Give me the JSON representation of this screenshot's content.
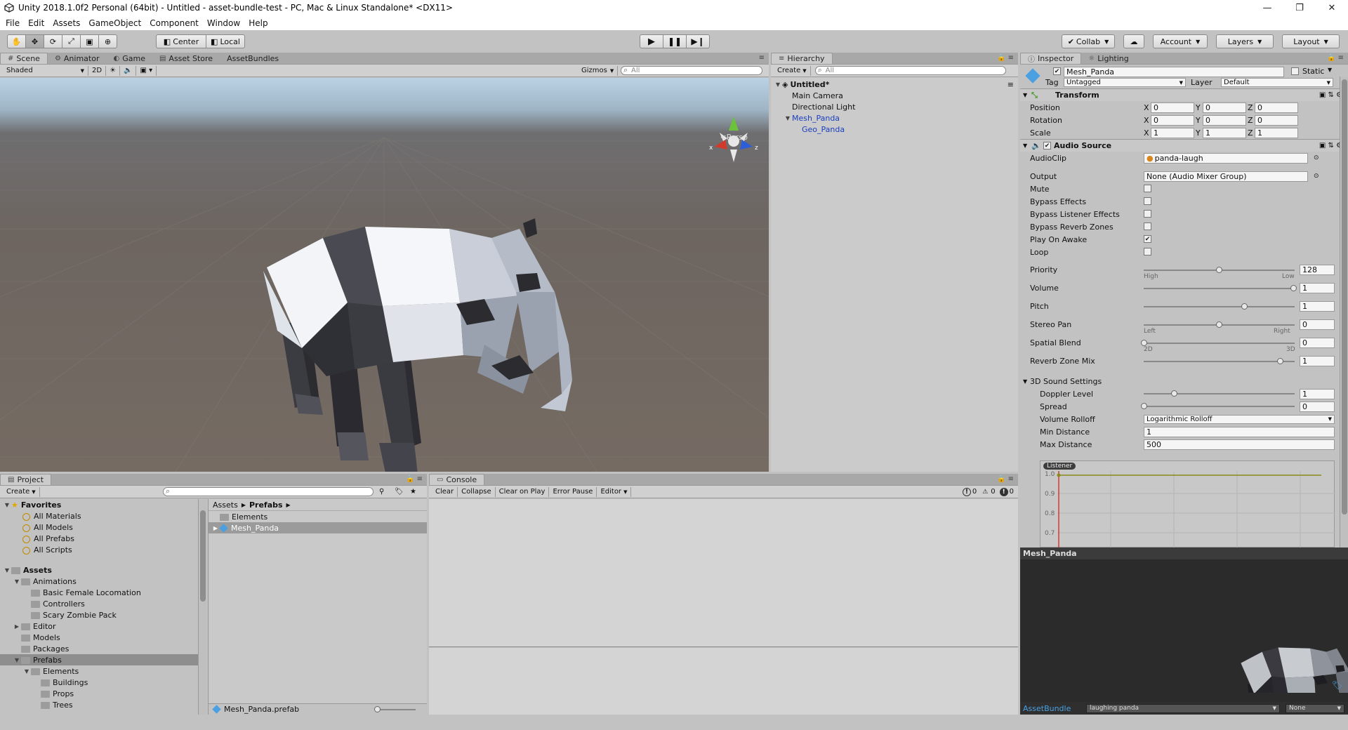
{
  "window": {
    "title": "Unity 2018.1.0f2 Personal (64bit) - Untitled - asset-bundle-test - PC, Mac & Linux Standalone* <DX11>"
  },
  "menu": [
    "File",
    "Edit",
    "Assets",
    "GameObject",
    "Component",
    "Window",
    "Help"
  ],
  "toolbar": {
    "pivot": "Center",
    "space": "Local",
    "collab": "Collab",
    "account": "Account",
    "layers": "Layers",
    "layout": "Layout"
  },
  "scene_panel": {
    "tabs": [
      "Scene",
      "Animator",
      "Game",
      "Asset Store",
      "AssetBundles"
    ],
    "shading": "Shaded",
    "mode_2d": "2D",
    "gizmos": "Gizmos",
    "search_placeholder": "All",
    "persp": "Persp"
  },
  "hierarchy": {
    "tab": "Hierarchy",
    "create": "Create",
    "search_placeholder": "All",
    "scene_name": "Untitled*",
    "items": [
      "Main Camera",
      "Directional Light",
      "Mesh_Panda",
      "Geo_Panda"
    ]
  },
  "inspector": {
    "tabs": [
      "Inspector",
      "Lighting"
    ],
    "object_name": "Mesh_Panda",
    "static_label": "Static",
    "tag_label": "Tag",
    "tag_value": "Untagged",
    "layer_label": "Layer",
    "layer_value": "Default",
    "transform": {
      "title": "Transform",
      "rows": [
        {
          "label": "Position",
          "x": "0",
          "y": "0",
          "z": "0"
        },
        {
          "label": "Rotation",
          "x": "0",
          "y": "0",
          "z": "0"
        },
        {
          "label": "Scale",
          "x": "1",
          "y": "1",
          "z": "1"
        }
      ],
      "axes": [
        "X",
        "Y",
        "Z"
      ]
    },
    "audio": {
      "title": "Audio Source",
      "audioclip_label": "AudioClip",
      "audioclip_value": "panda-laugh",
      "output_label": "Output",
      "output_value": "None (Audio Mixer Group)",
      "toggles": [
        {
          "label": "Mute",
          "checked": false
        },
        {
          "label": "Bypass Effects",
          "checked": false
        },
        {
          "label": "Bypass Listener Effects",
          "checked": false
        },
        {
          "label": "Bypass Reverb Zones",
          "checked": false
        },
        {
          "label": "Play On Awake",
          "checked": true
        },
        {
          "label": "Loop",
          "checked": false
        }
      ],
      "sliders": [
        {
          "label": "Priority",
          "value": "128",
          "pos": 0.5,
          "left": "High",
          "right": "Low"
        },
        {
          "label": "Volume",
          "value": "1",
          "pos": 1.0,
          "left": "",
          "right": ""
        },
        {
          "label": "Pitch",
          "value": "1",
          "pos": 0.67,
          "left": "",
          "right": ""
        },
        {
          "label": "Stereo Pan",
          "value": "0",
          "pos": 0.5,
          "left": "Left",
          "right": "Right"
        },
        {
          "label": "Spatial Blend",
          "value": "0",
          "pos": 0.0,
          "left": "2D",
          "right": "3D"
        },
        {
          "label": "Reverb Zone Mix",
          "value": "1",
          "pos": 0.91,
          "left": "",
          "right": ""
        }
      ],
      "sound3d": {
        "title": "3D Sound Settings",
        "doppler_label": "Doppler Level",
        "doppler_value": "1",
        "doppler_pos": 0.2,
        "spread_label": "Spread",
        "spread_value": "0",
        "spread_pos": 0.0,
        "rolloff_label": "Volume Rolloff",
        "rolloff_value": "Logarithmic Rolloff",
        "min_label": "Min Distance",
        "min_value": "1",
        "max_label": "Max Distance",
        "max_value": "500"
      },
      "graph": {
        "listener": "Listener",
        "ticks": [
          "1.0",
          "0.9",
          "0.8",
          "0.7"
        ]
      }
    }
  },
  "preview": {
    "title": "Mesh_Panda",
    "assetbundle_label": "AssetBundle",
    "assetbundle_value": "laughing panda",
    "variant_value": "None"
  },
  "project": {
    "tab": "Project",
    "create": "Create",
    "favorites_label": "Favorites",
    "favorites": [
      "All Materials",
      "All Models",
      "All Prefabs",
      "All Scripts"
    ],
    "assets_label": "Assets",
    "tree": [
      {
        "label": "Animations",
        "depth": 1,
        "arrow": "▼"
      },
      {
        "label": "Basic Female Locomation",
        "depth": 2,
        "arrow": ""
      },
      {
        "label": "Controllers",
        "depth": 2,
        "arrow": ""
      },
      {
        "label": "Scary Zombie Pack",
        "depth": 2,
        "arrow": ""
      },
      {
        "label": "Editor",
        "depth": 1,
        "arrow": "▶"
      },
      {
        "label": "Models",
        "depth": 1,
        "arrow": ""
      },
      {
        "label": "Packages",
        "depth": 1,
        "arrow": ""
      },
      {
        "label": "Prefabs",
        "depth": 1,
        "arrow": "▼"
      },
      {
        "label": "Elements",
        "depth": 2,
        "arrow": "▼"
      },
      {
        "label": "Buildings",
        "depth": 3,
        "arrow": ""
      },
      {
        "label": "Props",
        "depth": 3,
        "arrow": ""
      },
      {
        "label": "Trees",
        "depth": 3,
        "arrow": ""
      }
    ],
    "breadcrumb": [
      "Assets",
      "Prefabs"
    ],
    "files": [
      "Elements",
      "Mesh_Panda"
    ],
    "footer_file": "Mesh_Panda.prefab"
  },
  "console": {
    "tab": "Console",
    "buttons": [
      "Clear",
      "Collapse",
      "Clear on Play",
      "Error Pause",
      "Editor"
    ],
    "counts": {
      "info": "0",
      "warn": "0",
      "error": "0"
    }
  },
  "colors": {
    "gizmo_x": "#d33a2c",
    "gizmo_y": "#6cc23a",
    "gizmo_z": "#2b5ed8",
    "selection_blue": "#1a3fbf"
  }
}
